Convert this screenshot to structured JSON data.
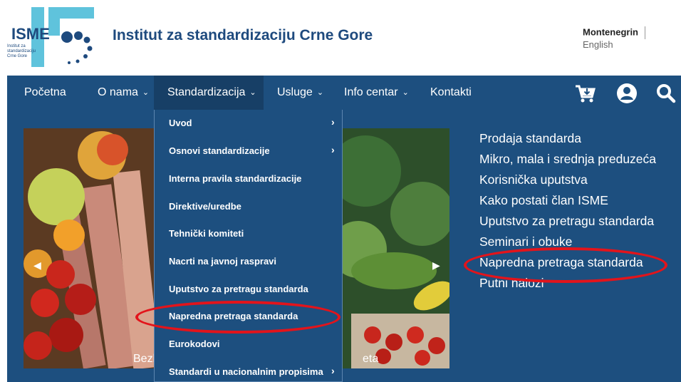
{
  "header": {
    "logo_text": "ISME",
    "logo_subtext": "Institut za standardizaciju Crne Gore",
    "site_title": "Institut za standardizaciju Crne Gore",
    "lang_active": "Montenegrin",
    "lang_other": "English"
  },
  "nav": {
    "items": [
      {
        "label": "Početna"
      },
      {
        "label": "O nama"
      },
      {
        "label": "Standardizacija"
      },
      {
        "label": "Usluge"
      },
      {
        "label": "Info centar"
      },
      {
        "label": "Kontakti"
      }
    ],
    "chevron": "⌄",
    "icons": [
      "cart-icon",
      "user-icon",
      "search-icon"
    ]
  },
  "dropdown": {
    "items": [
      {
        "label": "Uvod",
        "has_submenu": true
      },
      {
        "label": "Osnovi standardizacije",
        "has_submenu": true
      },
      {
        "label": "Interna pravila standardizacije",
        "has_submenu": false
      },
      {
        "label": "Direktive/uredbe",
        "has_submenu": false
      },
      {
        "label": "Tehnički komiteti",
        "has_submenu": false
      },
      {
        "label": "Nacrti na javnoj raspravi",
        "has_submenu": false
      },
      {
        "label": "Uputstvo za pretragu standarda",
        "has_submenu": false
      },
      {
        "label": "Napredna pretraga standarda",
        "has_submenu": false
      },
      {
        "label": "Eurokodovi",
        "has_submenu": false
      },
      {
        "label": "Standardi u nacionalnim propisima",
        "has_submenu": true
      }
    ],
    "submenu_arrow": "›"
  },
  "slider": {
    "caption_left": "Bezbje",
    "caption_right": "eta",
    "prev_arrow": "◀",
    "next_arrow": "▶"
  },
  "side_links": [
    {
      "label": "Prodaja standarda"
    },
    {
      "label": "Mikro, mala i srednja preduzeća"
    },
    {
      "label": "Korisnička uputstva"
    },
    {
      "label": "Kako postati član ISME"
    },
    {
      "label": "Uputstvo za pretragu standarda"
    },
    {
      "label": "Seminari i obuke"
    },
    {
      "label": "Napredna pretraga standarda"
    },
    {
      "label": "Putni nalozi"
    }
  ],
  "colors": {
    "nav_bg": "#1d4f7f",
    "nav_active": "#173f66",
    "title": "#1e4a7e",
    "logo_cyan": "#5fc3dc",
    "annotation_red": "#e3141b"
  }
}
